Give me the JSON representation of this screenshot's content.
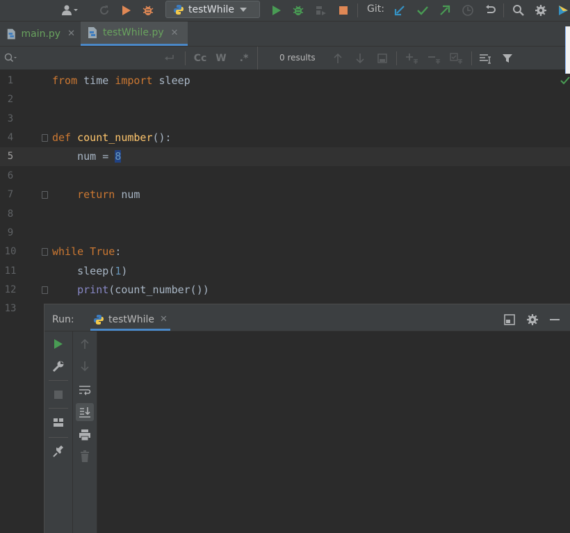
{
  "toolbar": {
    "icons": [
      "user-vcs-icon",
      "chevron-down-icon",
      "refresh-icon",
      "run-icon",
      "debug-icon",
      "run-coverage-icon",
      "debug-step-icon",
      "stop-icon",
      "git-update-icon",
      "git-commit-icon",
      "git-push-icon",
      "git-history-icon",
      "git-rollback-icon",
      "search-icon",
      "settings-icon",
      "plugin-icon"
    ],
    "run_config": "testWhile",
    "git_label": "Git:",
    "colors": {
      "run": "#499c54",
      "debug": "#e08855",
      "stop": "#c75450",
      "git_blue": "#3592c4",
      "git_green": "#499c54"
    }
  },
  "tabs": [
    {
      "label": "main.py",
      "active": false
    },
    {
      "label": "testWhile.py",
      "active": true
    }
  ],
  "search": {
    "results": "0 results",
    "options": [
      "Cc",
      "W",
      ".*"
    ]
  },
  "editor": {
    "current_line": 5,
    "line_numbers": [
      "1",
      "2",
      "3",
      "4",
      "5",
      "6",
      "7",
      "8",
      "9",
      "10",
      "11",
      "12",
      "13"
    ],
    "code": {
      "l1_from": "from",
      "l1_time": " time ",
      "l1_import": "import",
      "l1_sleep": " sleep",
      "l4_def": "def",
      "l4_name": " count_number",
      "l4_rest": "():",
      "l5_a": "    num = ",
      "l5_val": "8",
      "l7_return": "    return",
      "l7_var": " num",
      "l10_while": "while",
      "l10_true": " True",
      "l10_colon": ":",
      "l11_a": "    sleep(",
      "l11_n": "1",
      "l11_b": ")",
      "l12_print": "    print",
      "l12_rest": "(count_number())"
    }
  },
  "run_panel": {
    "title": "Run:",
    "tab_label": "testWhile",
    "console_text": ""
  }
}
